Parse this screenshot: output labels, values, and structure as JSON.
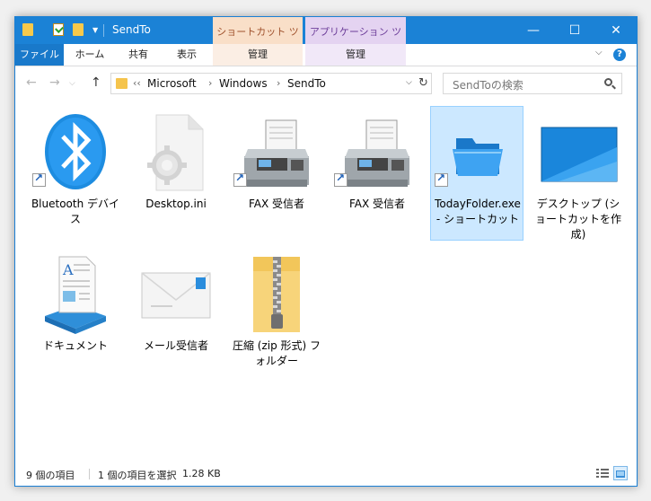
{
  "window": {
    "title": "SendTo",
    "context_tabs": [
      {
        "label": "ショートカット ツール",
        "color": "#f9dfc8"
      },
      {
        "label": "アプリケーション ツール",
        "color": "#e4d3f1"
      }
    ],
    "controls": {
      "minimize": "—",
      "maximize": "☐",
      "close": "✕"
    }
  },
  "ribbon": {
    "tabs": [
      {
        "label": "ファイル"
      },
      {
        "label": "ホーム"
      },
      {
        "label": "共有"
      },
      {
        "label": "表示"
      },
      {
        "label": "管理"
      },
      {
        "label": "管理"
      }
    ],
    "help": "?"
  },
  "address": {
    "overflow": "‹‹",
    "segments": [
      "Microsoft",
      "Windows",
      "SendTo"
    ],
    "separator": "›"
  },
  "search": {
    "placeholder": "SendToの検索"
  },
  "items": [
    {
      "label": "Bluetooth デバイス",
      "icon": "bluetooth-icon",
      "shortcut": true
    },
    {
      "label": "Desktop.ini",
      "icon": "settings-file-icon",
      "shortcut": false
    },
    {
      "label": "FAX 受信者",
      "icon": "fax-icon",
      "shortcut": true
    },
    {
      "label": "FAX 受信者",
      "icon": "fax-icon",
      "shortcut": true
    },
    {
      "label": "TodayFolder.exe - ショートカット",
      "icon": "folder-open-icon",
      "shortcut": true,
      "selected": true
    },
    {
      "label": "デスクトップ (ショートカットを作成)",
      "icon": "desktop-icon",
      "shortcut": false
    },
    {
      "label": "ドキュメント",
      "icon": "document-icon",
      "shortcut": false
    },
    {
      "label": "メール受信者",
      "icon": "mail-icon",
      "shortcut": false
    },
    {
      "label": "圧縮 (zip 形式) フォルダー",
      "icon": "zip-folder-icon",
      "shortcut": false
    }
  ],
  "status": {
    "count": "9 個の項目",
    "selection": "1 個の項目を選択",
    "size": "1.28 KB"
  },
  "colors": {
    "accent": "#1b82d6",
    "selection": "#cce8ff"
  }
}
